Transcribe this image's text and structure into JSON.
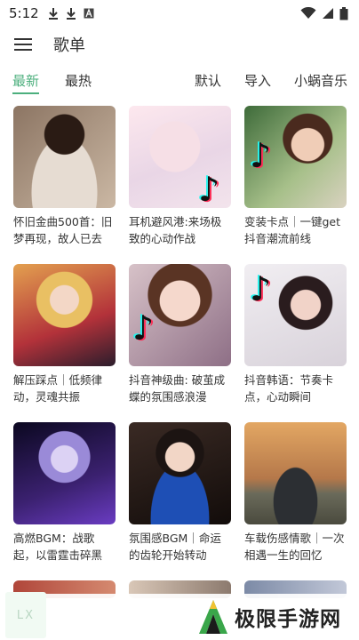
{
  "status": {
    "time": "5:12",
    "icons": [
      "download-icon",
      "download-icon",
      "a-letter-icon"
    ],
    "right_icons": [
      "wifi-icon",
      "cell-signal-icon",
      "battery-icon"
    ]
  },
  "appbar": {
    "title": "歌单",
    "menu_icon": "menu-icon"
  },
  "tabs": {
    "latest": "最新",
    "hot": "最热",
    "default": "默认",
    "import": "导入",
    "source": "小蜗音乐",
    "active": "latest",
    "accent_color": "#4caf7d"
  },
  "playlists": [
    {
      "name": "怀旧金曲500首：旧梦再现，故人已去"
    },
    {
      "name": "耳机避风港:来场极致的心动作战"
    },
    {
      "name": "变装卡点｜一键get抖音潮流前线"
    },
    {
      "name": "解压踩点｜低频律动，灵魂共振"
    },
    {
      "name": "抖音神级曲: 破茧成蝶的氛围感浪漫"
    },
    {
      "name": "抖音韩语：节奏卡点，心动瞬间"
    },
    {
      "name": "高燃BGM：战歌起，以雷霆击碎黑暗!"
    },
    {
      "name": "氛围感BGM｜命运的齿轮开始转动"
    },
    {
      "name": "车载伤感情歌｜一次相遇一生的回忆"
    }
  ],
  "floating": {
    "label": "LX"
  },
  "watermark": {
    "text": "极限手游网"
  }
}
